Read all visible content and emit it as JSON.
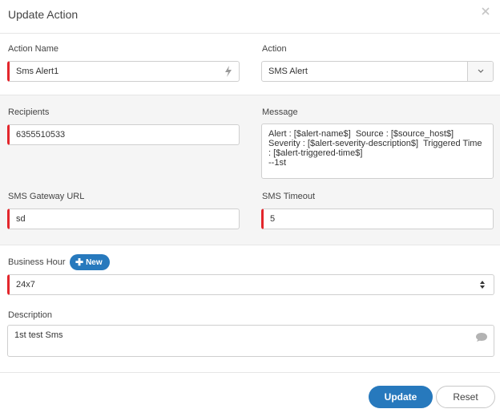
{
  "dialog": {
    "title": "Update Action",
    "close_icon": "close-icon"
  },
  "fields": {
    "action_name": {
      "label": "Action Name",
      "value": "Sms Alert1",
      "icon": "bolt-icon"
    },
    "action": {
      "label": "Action",
      "value": "SMS Alert",
      "icon": "chevron-down-icon"
    },
    "recipients": {
      "label": "Recipients",
      "value": "6355510533"
    },
    "message": {
      "label": "Message",
      "value": "Alert : [$alert-name$]  Source : [$source_host$]\nSeverity : [$alert-severity-description$]  Triggered Time\n: [$alert-triggered-time$]\n--1st"
    },
    "sms_gateway_url": {
      "label": "SMS Gateway URL",
      "value": "sd"
    },
    "sms_timeout": {
      "label": "SMS Timeout",
      "value": "5"
    },
    "business_hour": {
      "label": "Business Hour",
      "value": "24x7",
      "new_label": "New",
      "icon": "sort-icon"
    },
    "description": {
      "label": "Description",
      "value": "1st test Sms",
      "icon": "comment-icon"
    }
  },
  "footer": {
    "update_label": "Update",
    "reset_label": "Reset"
  },
  "colors": {
    "primary": "#2779bd",
    "required": "#e3262c",
    "section_bg": "#f5f5f5"
  }
}
